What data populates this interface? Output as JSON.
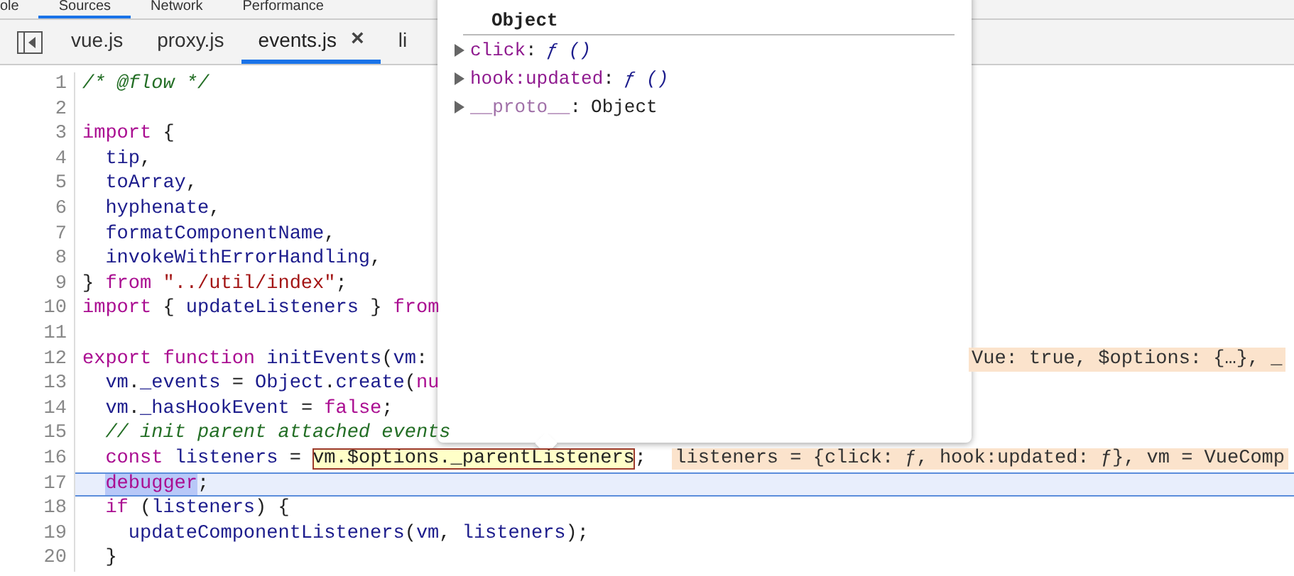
{
  "panel_tabs": [
    {
      "label": "ole",
      "selected": false
    },
    {
      "label": "Sources",
      "selected": true
    },
    {
      "label": "Network",
      "selected": false
    },
    {
      "label": "Performance",
      "selected": false
    }
  ],
  "file_tabs": [
    {
      "label": "vue.js",
      "selected": false,
      "closable": false
    },
    {
      "label": "proxy.js",
      "selected": false,
      "closable": false
    },
    {
      "label": "events.js",
      "selected": true,
      "closable": true,
      "close_glyph": "×"
    },
    {
      "label": "li",
      "selected": false,
      "closable": false
    }
  ],
  "code_lines": [
    {
      "number": "1",
      "paused": false,
      "tokens": [
        {
          "t": "/* @flow */",
          "kind": "comment"
        }
      ]
    },
    {
      "number": "2",
      "paused": false
    },
    {
      "number": "3",
      "paused": false,
      "tokens": [
        {
          "t": "import",
          "kind": "keyword"
        },
        {
          "t": " {",
          "kind": "plain"
        }
      ]
    },
    {
      "number": "4",
      "paused": false,
      "tokens": [
        {
          "t": "  tip",
          "kind": "name"
        },
        {
          "t": ",",
          "kind": "plain"
        }
      ]
    },
    {
      "number": "5",
      "paused": false,
      "tokens": [
        {
          "t": "  toArray",
          "kind": "name"
        },
        {
          "t": ",",
          "kind": "plain"
        }
      ]
    },
    {
      "number": "6",
      "paused": false,
      "tokens": [
        {
          "t": "  hyphenate",
          "kind": "name"
        },
        {
          "t": ",",
          "kind": "plain"
        }
      ]
    },
    {
      "number": "7",
      "paused": false,
      "tokens": [
        {
          "t": "  formatComponentName",
          "kind": "name"
        },
        {
          "t": ",",
          "kind": "plain"
        }
      ]
    },
    {
      "number": "8",
      "paused": false,
      "tokens": [
        {
          "t": "  invokeWithErrorHandling",
          "kind": "name"
        },
        {
          "t": ",",
          "kind": "plain"
        }
      ]
    },
    {
      "number": "9",
      "paused": false,
      "tokens": [
        {
          "t": "} ",
          "kind": "plain"
        },
        {
          "t": "from",
          "kind": "keyword"
        },
        {
          "t": " \"../util/index\"",
          "kind": "string"
        },
        {
          "t": ";",
          "kind": "plain"
        }
      ]
    },
    {
      "number": "10",
      "paused": false,
      "tokens": [
        {
          "t": "import",
          "kind": "keyword"
        },
        {
          "t": " { ",
          "kind": "plain"
        },
        {
          "t": "updateListeners",
          "kind": "name"
        },
        {
          "t": " } ",
          "kind": "plain"
        },
        {
          "t": "from",
          "kind": "keyword"
        }
      ]
    },
    {
      "number": "11",
      "paused": false
    },
    {
      "number": "12",
      "paused": false,
      "tokens": [
        {
          "t": "export",
          "kind": "keyword"
        },
        {
          "t": " function",
          "kind": "keyword"
        },
        {
          "t": " initEvents",
          "kind": "name"
        },
        {
          "t": "(",
          "kind": "plain"
        },
        {
          "t": "vm",
          "kind": "name"
        },
        {
          "t": ":",
          "kind": "plain"
        }
      ],
      "inline_value": "Vue: true, $options: {…}, _"
    },
    {
      "number": "13",
      "paused": false,
      "tokens": [
        {
          "t": "  vm",
          "kind": "name"
        },
        {
          "t": ".",
          "kind": "plain"
        },
        {
          "t": "_events",
          "kind": "name"
        },
        {
          "t": " = ",
          "kind": "plain"
        },
        {
          "t": "Object",
          "kind": "name"
        },
        {
          "t": ".",
          "kind": "plain"
        },
        {
          "t": "create",
          "kind": "name"
        },
        {
          "t": "(",
          "kind": "plain"
        },
        {
          "t": "nu",
          "kind": "keyword"
        }
      ]
    },
    {
      "number": "14",
      "paused": false,
      "tokens": [
        {
          "t": "  vm",
          "kind": "name"
        },
        {
          "t": ".",
          "kind": "plain"
        },
        {
          "t": "_hasHookEvent",
          "kind": "name"
        },
        {
          "t": " = ",
          "kind": "plain"
        },
        {
          "t": "false",
          "kind": "keyword"
        },
        {
          "t": ";",
          "kind": "plain"
        }
      ]
    },
    {
      "number": "15",
      "paused": false,
      "tokens": [
        {
          "t": "  // init parent attached events",
          "kind": "comment"
        }
      ]
    },
    {
      "number": "16",
      "paused": false,
      "tokens": [
        {
          "t": "  const",
          "kind": "keyword"
        },
        {
          "t": " listeners",
          "kind": "name"
        },
        {
          "t": " = ",
          "kind": "plain"
        },
        {
          "t": "vm.$options._parentListeners",
          "kind": "hovered"
        },
        {
          "t": ";",
          "kind": "plain"
        }
      ],
      "inline_value": "listeners = {click: ƒ, hook:updated: ƒ}, vm = VueComp"
    },
    {
      "number": "17",
      "paused": true,
      "tokens": [
        {
          "t": "  debugger",
          "kind": "selected"
        },
        {
          "t": ";",
          "kind": "plain"
        }
      ]
    },
    {
      "number": "18",
      "paused": false,
      "tokens": [
        {
          "t": "  if",
          "kind": "keyword"
        },
        {
          "t": " (",
          "kind": "plain"
        },
        {
          "t": "listeners",
          "kind": "name"
        },
        {
          "t": ") {",
          "kind": "plain"
        }
      ]
    },
    {
      "number": "19",
      "paused": false,
      "tokens": [
        {
          "t": "    updateComponentListeners",
          "kind": "name"
        },
        {
          "t": "(",
          "kind": "plain"
        },
        {
          "t": "vm",
          "kind": "name"
        },
        {
          "t": ", ",
          "kind": "plain"
        },
        {
          "t": "listeners",
          "kind": "name"
        },
        {
          "t": ");",
          "kind": "plain"
        }
      ]
    },
    {
      "number": "20",
      "paused": false,
      "tokens": [
        {
          "t": "  }",
          "kind": "plain"
        }
      ]
    }
  ],
  "popover": {
    "title": "Object",
    "separator": ":",
    "properties": [
      {
        "name": "click",
        "value": "ƒ ()",
        "kind": "function"
      },
      {
        "name": "hook:updated",
        "value": "ƒ ()",
        "kind": "function"
      },
      {
        "name": "__proto__",
        "value": "Object",
        "kind": "internal"
      }
    ]
  }
}
